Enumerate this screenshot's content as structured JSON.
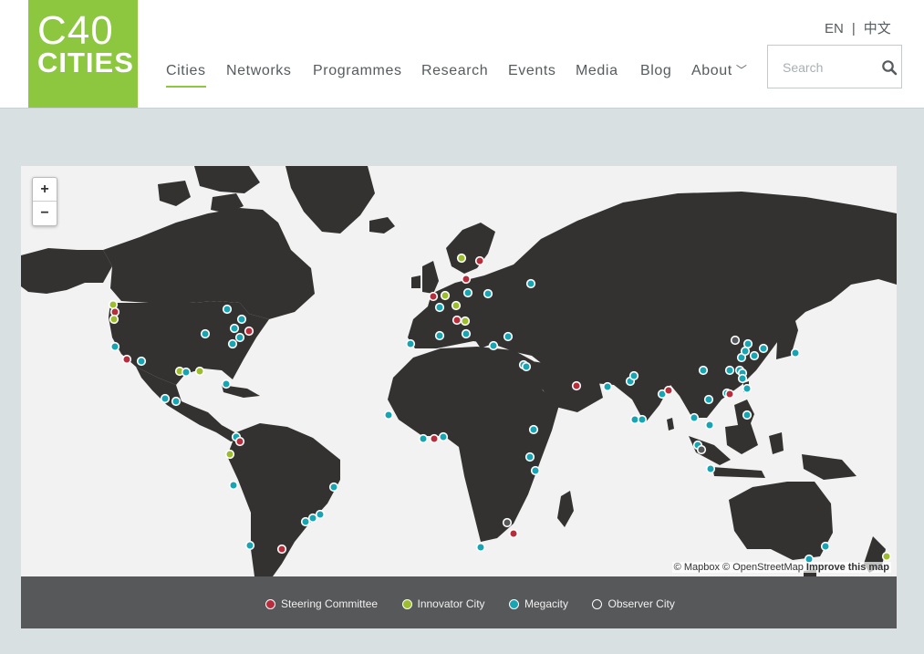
{
  "logo": {
    "line1": "C40",
    "line2": "CITIES"
  },
  "nav": {
    "items": [
      "Cities",
      "Networks",
      "Programmes",
      "Research",
      "Events",
      "Media",
      "Blog",
      "About"
    ]
  },
  "lang": {
    "en": "EN",
    "separator": "|",
    "zh": "中文"
  },
  "search": {
    "placeholder": "Search",
    "icon": "search-icon"
  },
  "map": {
    "zoom_in": "+",
    "zoom_out": "−",
    "attribution": {
      "mapbox": "© Mapbox",
      "osm": "© OpenStreetMap",
      "improve": "Improve this map"
    }
  },
  "legend": [
    {
      "label": "Steering Committee",
      "color": "#b82d3c"
    },
    {
      "label": "Innovator City",
      "color": "#9cbe2e"
    },
    {
      "label": "Megacity",
      "color": "#18a5b3"
    },
    {
      "label": "Observer City",
      "color": "#57585a"
    }
  ],
  "colors": {
    "brand_green": "#8dc63f",
    "land": "#333230",
    "ocean": "#f2f2f2",
    "legend_bg": "#57585a"
  }
}
